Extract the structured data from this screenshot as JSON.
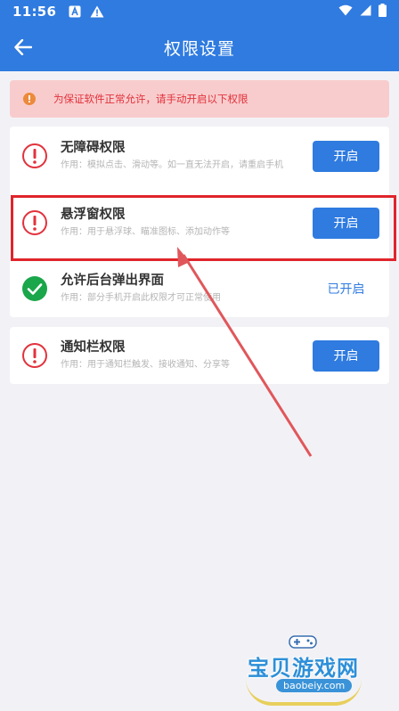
{
  "statusbar": {
    "time": "11:56",
    "icons_left": [
      "a-box-icon",
      "warning-triangle-icon"
    ],
    "icons_right": [
      "wifi-icon",
      "signal-icon",
      "battery-icon"
    ]
  },
  "appbar": {
    "title": "权限设置",
    "back_icon": "arrow-left-icon"
  },
  "notice": {
    "text": "为保证软件正常允许，请手动开启以下权限",
    "icon": "info-dot-icon"
  },
  "permissions": [
    {
      "name": "无障碍权限",
      "desc": "作用：模拟点击、滑动等。如一直无法开启，请重启手机",
      "state": "off",
      "action_label": "开启"
    },
    {
      "name": "悬浮窗权限",
      "desc": "作用：用于悬浮球、瞄准图标、添加动作等",
      "state": "off",
      "action_label": "开启"
    },
    {
      "name": "允许后台弹出界面",
      "desc": "作用：部分手机开启此权限才可正常使用",
      "state": "on",
      "action_label": "已开启"
    },
    {
      "name": "通知栏权限",
      "desc": "作用：用于通知栏触发、接收通知、分享等",
      "state": "off",
      "action_label": "开启"
    }
  ],
  "watermark": {
    "title": "宝贝游戏网",
    "url": "baobeiy.com"
  },
  "colors": {
    "primary": "#2f7be0",
    "alert_red": "#e2323c",
    "notice_bg": "#f8cccd",
    "success_green": "#1aa64a",
    "highlight_red": "#e0242b"
  }
}
